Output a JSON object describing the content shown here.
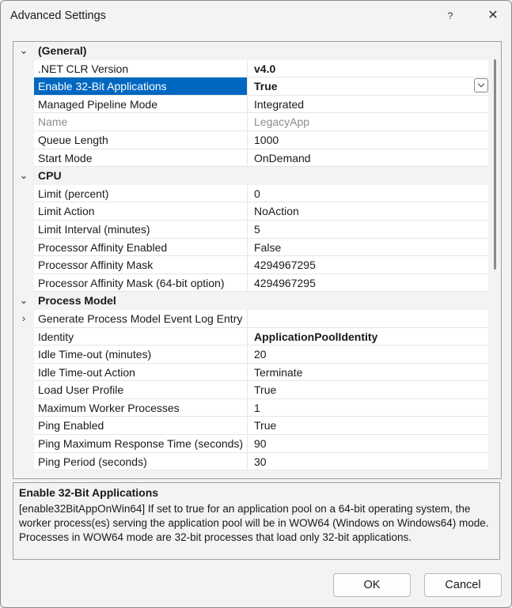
{
  "window": {
    "title": "Advanced Settings",
    "help_glyph": "?",
    "close_glyph": "✕"
  },
  "grid": {
    "rows": [
      {
        "type": "category",
        "name": "(General)",
        "expander": "⌄"
      },
      {
        "type": "prop",
        "name": ".NET CLR Version",
        "value": "v4.0",
        "bold": true
      },
      {
        "type": "prop",
        "name": "Enable 32-Bit Applications",
        "value": "True",
        "bold": true,
        "selected": true,
        "dropdown": true
      },
      {
        "type": "prop",
        "name": "Managed Pipeline Mode",
        "value": "Integrated"
      },
      {
        "type": "prop",
        "name": "Name",
        "value": "LegacyApp",
        "disabled": true
      },
      {
        "type": "prop",
        "name": "Queue Length",
        "value": "1000"
      },
      {
        "type": "prop",
        "name": "Start Mode",
        "value": "OnDemand"
      },
      {
        "type": "category",
        "name": "CPU",
        "expander": "⌄"
      },
      {
        "type": "prop",
        "name": "Limit (percent)",
        "value": "0"
      },
      {
        "type": "prop",
        "name": "Limit Action",
        "value": "NoAction"
      },
      {
        "type": "prop",
        "name": "Limit Interval (minutes)",
        "value": "5"
      },
      {
        "type": "prop",
        "name": "Processor Affinity Enabled",
        "value": "False"
      },
      {
        "type": "prop",
        "name": "Processor Affinity Mask",
        "value": "4294967295"
      },
      {
        "type": "prop",
        "name": "Processor Affinity Mask (64-bit option)",
        "value": "4294967295"
      },
      {
        "type": "category",
        "name": "Process Model",
        "expander": "⌄"
      },
      {
        "type": "prop",
        "name": "Generate Process Model Event Log Entry",
        "value": "",
        "expander": "›"
      },
      {
        "type": "prop",
        "name": "Identity",
        "value": "ApplicationPoolIdentity",
        "bold": true
      },
      {
        "type": "prop",
        "name": "Idle Time-out (minutes)",
        "value": "20"
      },
      {
        "type": "prop",
        "name": "Idle Time-out Action",
        "value": "Terminate"
      },
      {
        "type": "prop",
        "name": "Load User Profile",
        "value": "True"
      },
      {
        "type": "prop",
        "name": "Maximum Worker Processes",
        "value": "1"
      },
      {
        "type": "prop",
        "name": "Ping Enabled",
        "value": "True"
      },
      {
        "type": "prop",
        "name": "Ping Maximum Response Time (seconds)",
        "value": "90"
      },
      {
        "type": "prop",
        "name": "Ping Period (seconds)",
        "value": "30"
      }
    ]
  },
  "description": {
    "title": "Enable 32-Bit Applications",
    "text": "[enable32BitAppOnWin64] If set to true for an application pool on a 64-bit operating system, the worker process(es) serving the application pool will be in WOW64 (Windows on Windows64) mode. Processes in WOW64 mode are 32-bit processes that load only 32-bit applications."
  },
  "buttons": {
    "ok": "OK",
    "cancel": "Cancel"
  },
  "dropdown_glyph": "⌵"
}
